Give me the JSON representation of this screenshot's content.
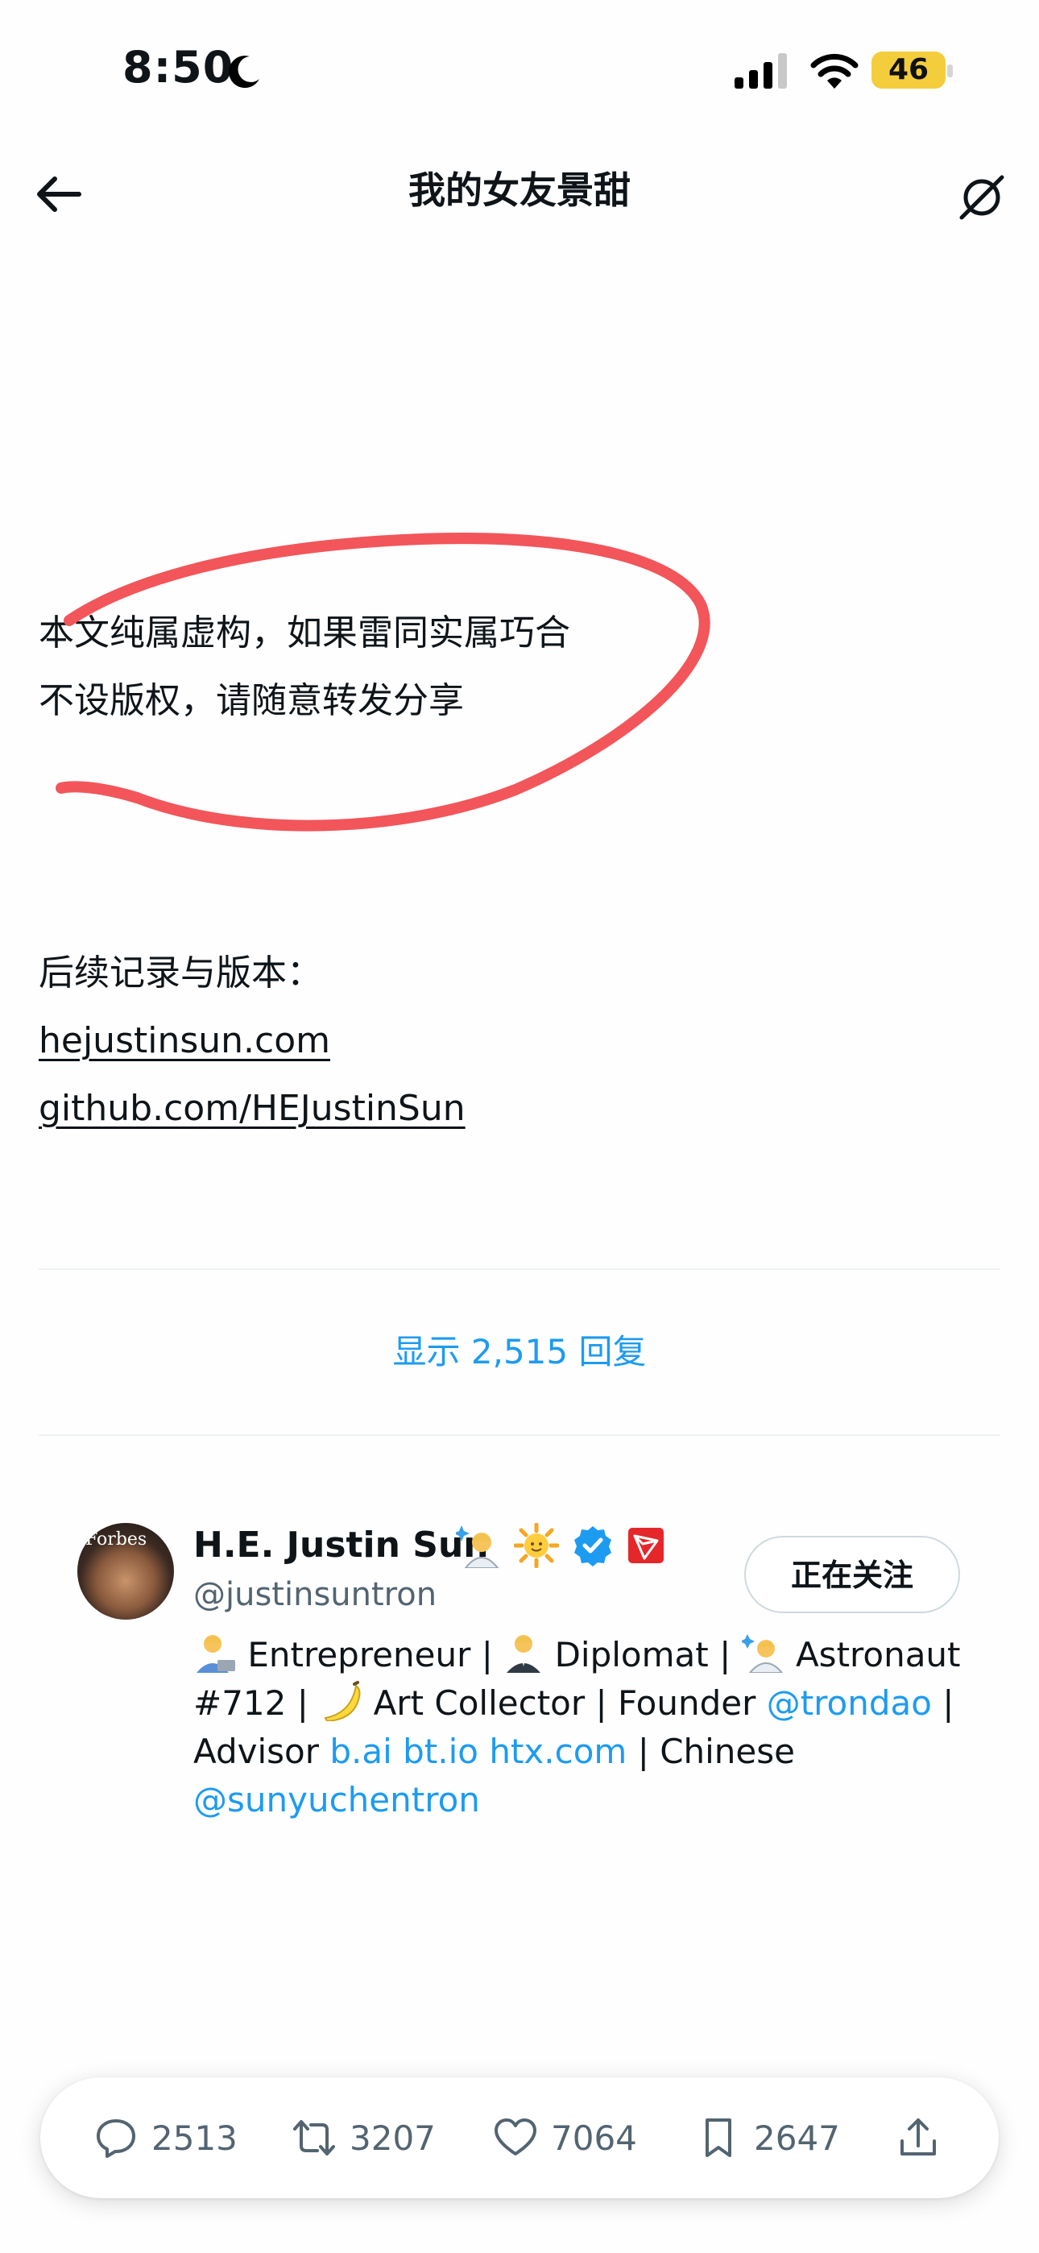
{
  "status_bar": {
    "time": "8:50",
    "battery": "46"
  },
  "nav": {
    "title": "我的女友景甜"
  },
  "article": {
    "line1": "本文纯属虚构，如果雷同实属巧合",
    "line2": "不设版权，请随意转发分享",
    "line3": "后续记录与版本：",
    "link1": "hejustinsun.com",
    "link2": "github.com/HEJustinSun"
  },
  "replies_label": "显示 2,515 回复",
  "profile": {
    "avatar_text": "Forbes",
    "name": "H.E. Justin Sun",
    "handle": "@justinsuntron",
    "follow_label": "正在关注",
    "bio": {
      "l1_a": "Entrepreneur | ",
      "l1_b": "Diplomat | ",
      "l1_c": "Astronaut",
      "l2_a": "#712 | ",
      "l2_b": "Art Collector | Founder ",
      "l2_mention": "@trondao",
      "l2_end": " |",
      "l3_a": "Advisor ",
      "l3_links": "b.ai bt.io htx.com",
      "l3_end": " | Chinese",
      "l4_mention": "@sunyuchentron"
    }
  },
  "actions": {
    "replies": "2513",
    "reposts": "3207",
    "likes": "7064",
    "bookmarks": "2647"
  },
  "colors": {
    "accent": "#1d9bf0",
    "scribble": "#f2555a",
    "battery": "#f4cd3c",
    "muted": "#536471"
  }
}
